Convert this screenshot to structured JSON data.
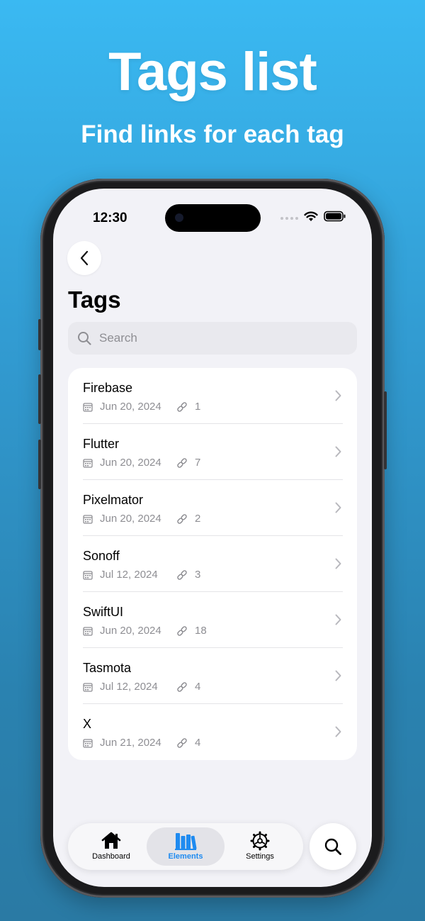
{
  "promo": {
    "title": "Tags list",
    "subtitle": "Find links for each tag"
  },
  "status_bar": {
    "time": "12:30"
  },
  "header": {
    "title": "Tags"
  },
  "search": {
    "placeholder": "Search"
  },
  "tags": [
    {
      "name": "Firebase",
      "date": "Jun 20, 2024",
      "links": "1"
    },
    {
      "name": "Flutter",
      "date": "Jun 20, 2024",
      "links": "7"
    },
    {
      "name": "Pixelmator",
      "date": "Jun 20, 2024",
      "links": "2"
    },
    {
      "name": "Sonoff",
      "date": "Jul 12, 2024",
      "links": "3"
    },
    {
      "name": "SwiftUI",
      "date": "Jun 20, 2024",
      "links": "18"
    },
    {
      "name": "Tasmota",
      "date": "Jul 12, 2024",
      "links": "4"
    },
    {
      "name": "X",
      "date": "Jun 21, 2024",
      "links": "4"
    }
  ],
  "tab_bar": {
    "tabs": [
      {
        "label": "Dashboard",
        "icon": "house-icon",
        "active": false
      },
      {
        "label": "Elements",
        "icon": "books-icon",
        "active": true
      },
      {
        "label": "Settings",
        "icon": "gear-icon",
        "active": false
      }
    ],
    "search_icon": "magnifier-icon"
  },
  "colors": {
    "accent": "#1f8bf0",
    "background_top": "#3ab9f2",
    "background_bottom": "#2a7aa4",
    "screen_background": "#f2f2f7"
  }
}
